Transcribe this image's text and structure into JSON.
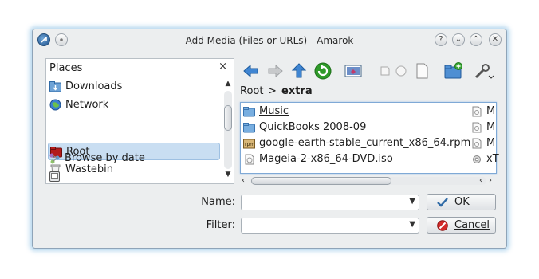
{
  "window": {
    "title": "Add Media (Files or URLs) - Amarok",
    "buttons": {
      "help": "?",
      "shade": "⌄",
      "maximize": "⌃",
      "close": "✕"
    }
  },
  "places": {
    "title": "Places",
    "close": "×",
    "items": [
      {
        "label": "Downloads",
        "icon": "downloads-folder-icon"
      },
      {
        "label": "Network",
        "icon": "network-globe-icon"
      },
      {
        "label": "Root",
        "icon": "root-folder-icon"
      },
      {
        "label": "Wastebin",
        "icon": "wastebin-icon"
      },
      {
        "label": "Browse by date",
        "icon": "calendar-tree-icon"
      },
      {
        "label": "",
        "icon": "drive-icon"
      }
    ],
    "selected": "Root"
  },
  "toolbar": {
    "icons": [
      "back-arrow-icon",
      "forward-arrow-icon",
      "up-arrow-icon",
      "reload-icon",
      "preview-icon",
      "icon-view-icon",
      "detail-view-icon",
      "document-icon",
      "new-folder-icon",
      "options-wrench-icon"
    ]
  },
  "breadcrumb": {
    "root": "Root",
    "separator": ">",
    "current": "extra"
  },
  "files": [
    {
      "name": "Music",
      "type": "folder",
      "col2": "M"
    },
    {
      "name": "QuickBooks 2008-09",
      "type": "folder",
      "col2": "M"
    },
    {
      "name": "google-earth-stable_current_x86_64.rpm",
      "type": "rpm",
      "col2": "M"
    },
    {
      "name": "Mageia-2-x86_64-DVD.iso",
      "type": "iso",
      "col2": "xT"
    }
  ],
  "form": {
    "name_label": "Name:",
    "name_value": "",
    "filter_label": "Filter:",
    "filter_value": ""
  },
  "buttons": {
    "ok": "OK",
    "cancel": "Cancel"
  },
  "colors": {
    "accent": "#3d82c5",
    "selection": "#c9def2",
    "root_folder": "#a81414"
  }
}
